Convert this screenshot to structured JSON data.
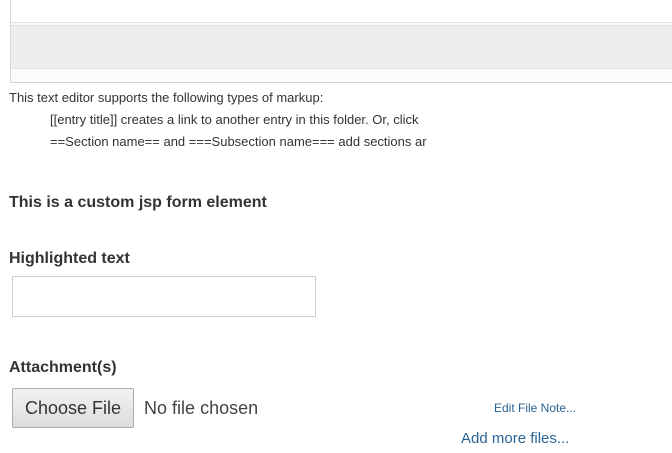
{
  "markup_help": {
    "intro": "This text editor supports the following types of markup:",
    "line_links": "[[entry title]] creates a link to another entry in this folder. Or, click",
    "line_sections": "==Section name== and ===Subsection name=== add sections ar"
  },
  "custom_element_text": "This is a custom jsp form element",
  "highlighted_text": {
    "label": "Highlighted text",
    "value": ""
  },
  "attachments": {
    "label": "Attachment(s)",
    "choose_file_label": "Choose File",
    "no_file_text": "No file chosen",
    "edit_file_note_link": "Edit File Note...",
    "add_more_files_link": "Add more files..."
  },
  "colors": {
    "link": "#2a6496",
    "text": "#333333"
  }
}
